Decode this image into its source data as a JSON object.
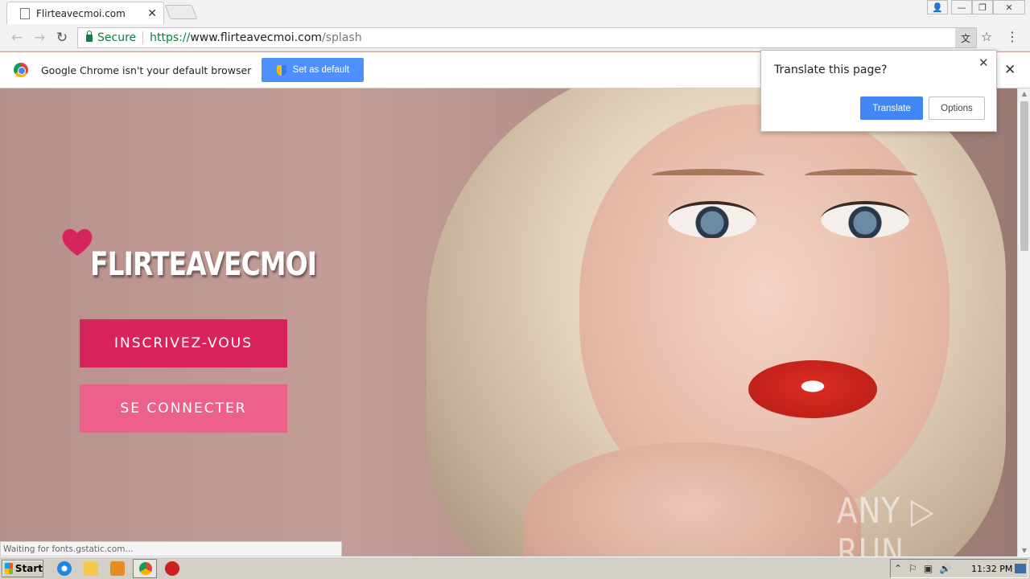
{
  "browser": {
    "tab_title": "Flirteavecmoi.com",
    "tab_close": "✕",
    "controls": {
      "user": "👤",
      "minimize": "—",
      "maximize": "❐",
      "close": "✕"
    },
    "nav": {
      "back": "←",
      "forward": "→",
      "reload": "↻"
    },
    "address": {
      "secure_label": "Secure",
      "scheme": "https://",
      "host": "www.flirteavecmoi.com",
      "path": "/splash"
    },
    "translate_icon": "文",
    "star": "☆",
    "menu": "⋮"
  },
  "infobar": {
    "message": "Google Chrome isn't your default browser",
    "button_label": "Set as default",
    "close": "✕"
  },
  "translate_popup": {
    "title": "Translate this page?",
    "translate_label": "Translate",
    "options_label": "Options",
    "close": "✕"
  },
  "page": {
    "logo_text": "FLIRTEAVECMOI",
    "register_label": "INSCRIVEZ-VOUS",
    "login_label": "SE CONNECTER",
    "status_text": "Waiting for fonts.gstatic.com...",
    "watermark": "ANY ▷ RUN"
  },
  "scrollbar": {
    "up": "▲",
    "down": "▼"
  },
  "taskbar": {
    "start_label": "Start",
    "tray_icons": "⌃⚐▣🔊",
    "clock": "11:32 PM"
  },
  "colors": {
    "register_btn": "#d7245c",
    "login_btn": "#ec6089",
    "accent_blue": "#4285f4",
    "secure_green": "#0b8043"
  }
}
